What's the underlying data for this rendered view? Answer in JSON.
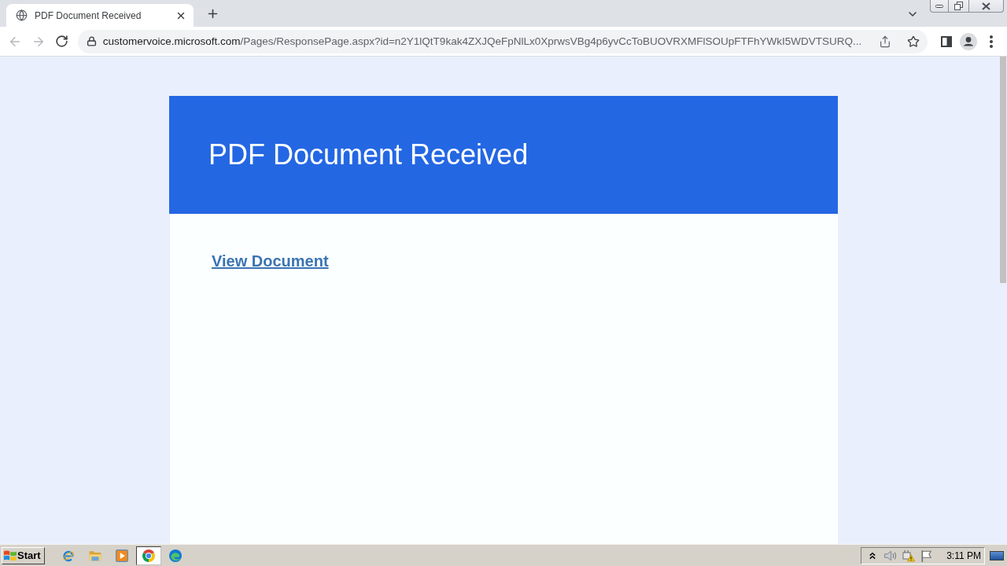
{
  "browser": {
    "tabs": [
      {
        "title": "PDF Document Received",
        "selected": true
      }
    ],
    "nav": {
      "back": {
        "disabled": true
      },
      "forward": {
        "disabled": true
      }
    },
    "address_bar": {
      "domain": "customervoice.microsoft.com",
      "path": "/Pages/ResponsePage.aspx?id=n2Y1lQtT9kak4ZXJQeFpNlLx0XprwsVBg4p6yvCcToBUOVRXMFlSOUpFTFhYWkI5WDVTSURQ..."
    }
  },
  "page": {
    "header_title": "PDF Document Received",
    "link": "View Document"
  },
  "taskbar": {
    "start": "Start",
    "apps": [
      {
        "kind": "ie",
        "selected": false
      },
      {
        "kind": "folder",
        "selected": false
      },
      {
        "kind": "media",
        "selected": false
      },
      {
        "kind": "chrome",
        "selected": true
      },
      {
        "kind": "edge",
        "selected": false
      }
    ],
    "tray": [
      {
        "kind": "chevron"
      },
      {
        "kind": "speaker"
      },
      {
        "kind": "network"
      },
      {
        "kind": "flag"
      }
    ],
    "clock": "3:11 PM"
  }
}
